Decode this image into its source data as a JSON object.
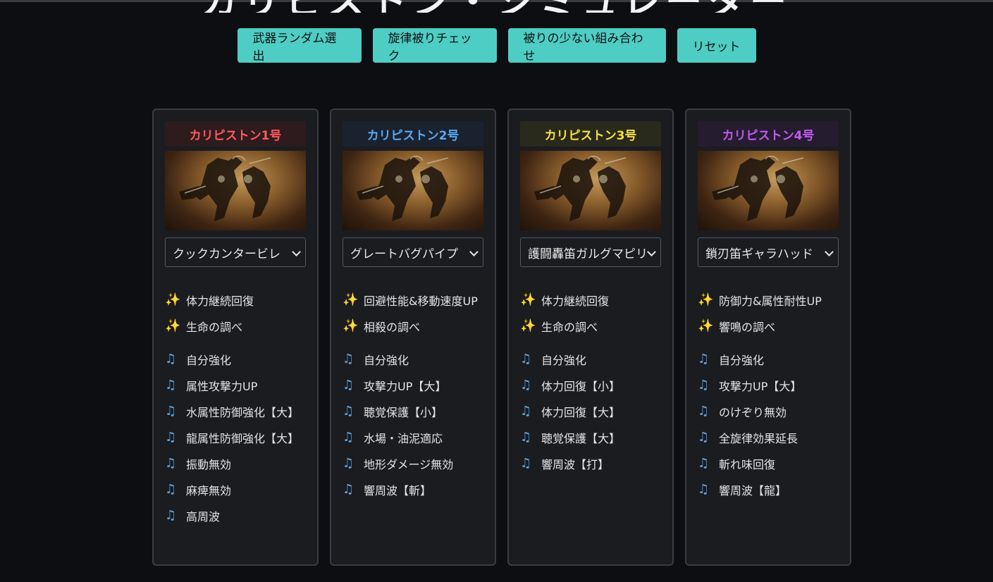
{
  "header": {
    "title_fragment": "カリピストン・シミュレーター"
  },
  "toolbar": {
    "buttons": [
      {
        "label": "武器ランダム選出"
      },
      {
        "label": "旋律被りチェック"
      },
      {
        "label": "被りの少ない組み合わせ"
      },
      {
        "label": "リセット"
      }
    ]
  },
  "colors": {
    "accent": "#4ecdc4",
    "card1": "#ff5a5a",
    "card2": "#5aa7f0",
    "card3": "#f4e04a",
    "card4": "#c05af0"
  },
  "cards": [
    {
      "title": "カリピストン1号",
      "title_color": "#ff5a5a",
      "title_bg": "#2e1b1e",
      "weapon": "クックカンタービレ",
      "specials": [
        "体力継続回復",
        "生命の調べ"
      ],
      "melodies": [
        "自分強化",
        "属性攻撃力UP",
        "水属性防御強化【大】",
        "龍属性防御強化【大】",
        "振動無効",
        "麻痺無効",
        "高周波"
      ]
    },
    {
      "title": "カリピストン2号",
      "title_color": "#5aa7f0",
      "title_bg": "#1a2230",
      "weapon": "グレートバグパイプ",
      "specials": [
        "回避性能&移動速度UP",
        "相殺の調べ"
      ],
      "melodies": [
        "自分強化",
        "攻撃力UP【大】",
        "聴覚保護【小】",
        "水場・油泥適応",
        "地形ダメージ無効",
        "響周波【斬】"
      ]
    },
    {
      "title": "カリピストン3号",
      "title_color": "#f4e04a",
      "title_bg": "#2a2a1c",
      "weapon": "護闘轟笛ガルグマピリ",
      "specials": [
        "体力継続回復",
        "生命の調べ"
      ],
      "melodies": [
        "自分強化",
        "体力回復【小】",
        "体力回復【大】",
        "聴覚保護【大】",
        "響周波【打】"
      ]
    },
    {
      "title": "カリピストン4号",
      "title_color": "#c05af0",
      "title_bg": "#261c30",
      "weapon": "鎖刃笛ギャラハッド",
      "specials": [
        "防御力&属性耐性UP",
        "響鳴の調べ"
      ],
      "melodies": [
        "自分強化",
        "攻撃力UP【大】",
        "のけぞり無効",
        "全旋律効果延長",
        "斬れ味回復",
        "響周波【龍】"
      ]
    }
  ],
  "icons": {
    "special": "sparkles-icon",
    "melody": "music-note-icon",
    "select": "chevron-down-icon"
  }
}
